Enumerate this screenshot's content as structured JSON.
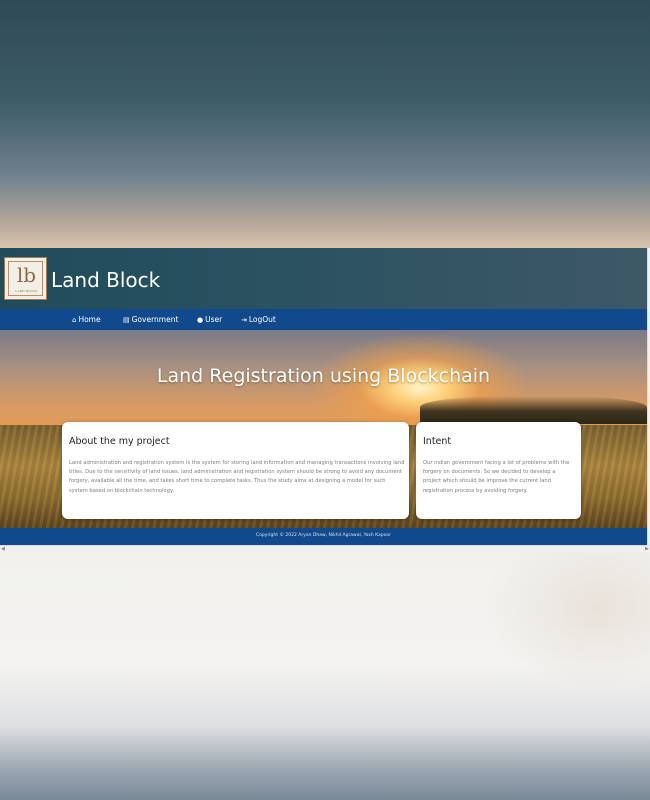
{
  "site": {
    "brand": "Land Block",
    "logo_mark": "lb",
    "logo_sub": "LAND BLOCK"
  },
  "nav": {
    "items": [
      {
        "label": "Home",
        "icon": "home-icon",
        "glyph": "⌂"
      },
      {
        "label": "Government",
        "icon": "bank-icon",
        "glyph": "⌂"
      },
      {
        "label": "User",
        "icon": "user-icon",
        "glyph": "☻"
      },
      {
        "label": "LogOut",
        "icon": "logout-icon",
        "glyph": "⇥"
      }
    ]
  },
  "hero": {
    "title": "Land Registration using Blockchain"
  },
  "cards": {
    "about": {
      "title": "About the my project",
      "text": "Land administration and registration system is the system for storing land information and managing transactions involving land titles. Due to the sensitivity of land issues, land administration and registration system should be strong to avoid any document forgery, available all the time, and takes short time to complete tasks. Thus the study aims at designing a model for such system based on blockchain technology."
    },
    "intent": {
      "title": "Intent",
      "text": "Our indian government facing a lot of problems with the forgery on documents. So we decided to develop a project which should be improve the current land registration process by avoiding forgery."
    }
  },
  "footer": {
    "text": "Copyright © 2022 Aryan Dhaw, Nikhil Agrawal, Yash Kapoor"
  },
  "colors": {
    "navbar": "#114a8c",
    "header": "#2b5261",
    "card_bg": "#ffffff"
  }
}
